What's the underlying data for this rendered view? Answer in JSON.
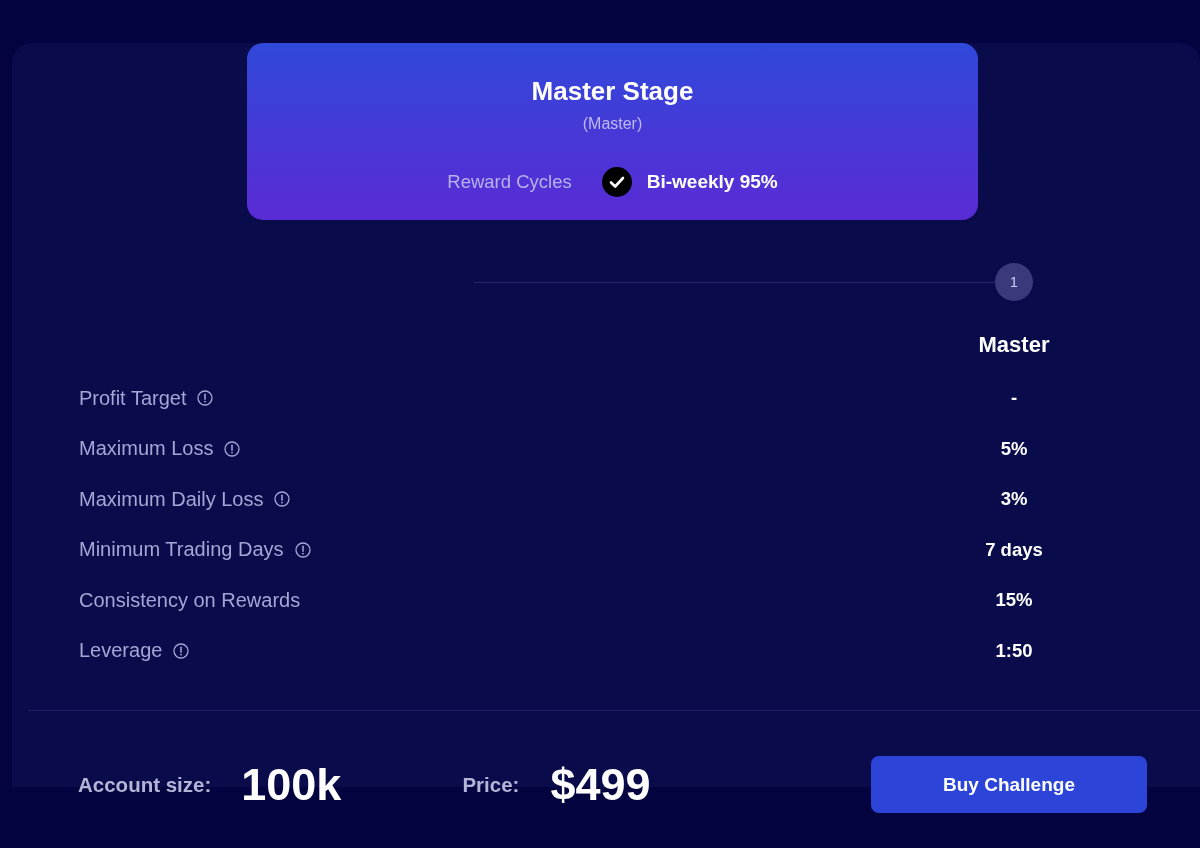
{
  "plan_card": {
    "title": "Master Stage",
    "subtitle": "(Master)",
    "reward_cycles": {
      "label": "Reward Cycles",
      "value": "Bi-weekly 95%",
      "checked": true
    }
  },
  "stepper": {
    "steps": [
      {
        "number": "1"
      }
    ]
  },
  "table": {
    "columns": [
      "Master"
    ],
    "rows": [
      {
        "label": "Profit Target",
        "info": true,
        "values": [
          "-"
        ]
      },
      {
        "label": "Maximum Loss",
        "info": true,
        "values": [
          "5%"
        ]
      },
      {
        "label": "Maximum Daily Loss",
        "info": true,
        "values": [
          "3%"
        ]
      },
      {
        "label": "Minimum Trading Days",
        "info": true,
        "values": [
          "7 days"
        ]
      },
      {
        "label": "Consistency on Rewards",
        "info": false,
        "values": [
          "15%"
        ]
      },
      {
        "label": "Leverage",
        "info": true,
        "values": [
          "1:50"
        ]
      }
    ]
  },
  "footer": {
    "account_size": {
      "label": "Account size:",
      "value": "100k"
    },
    "price": {
      "label": "Price:",
      "value": "$499"
    },
    "button": "Buy Challenge"
  }
}
